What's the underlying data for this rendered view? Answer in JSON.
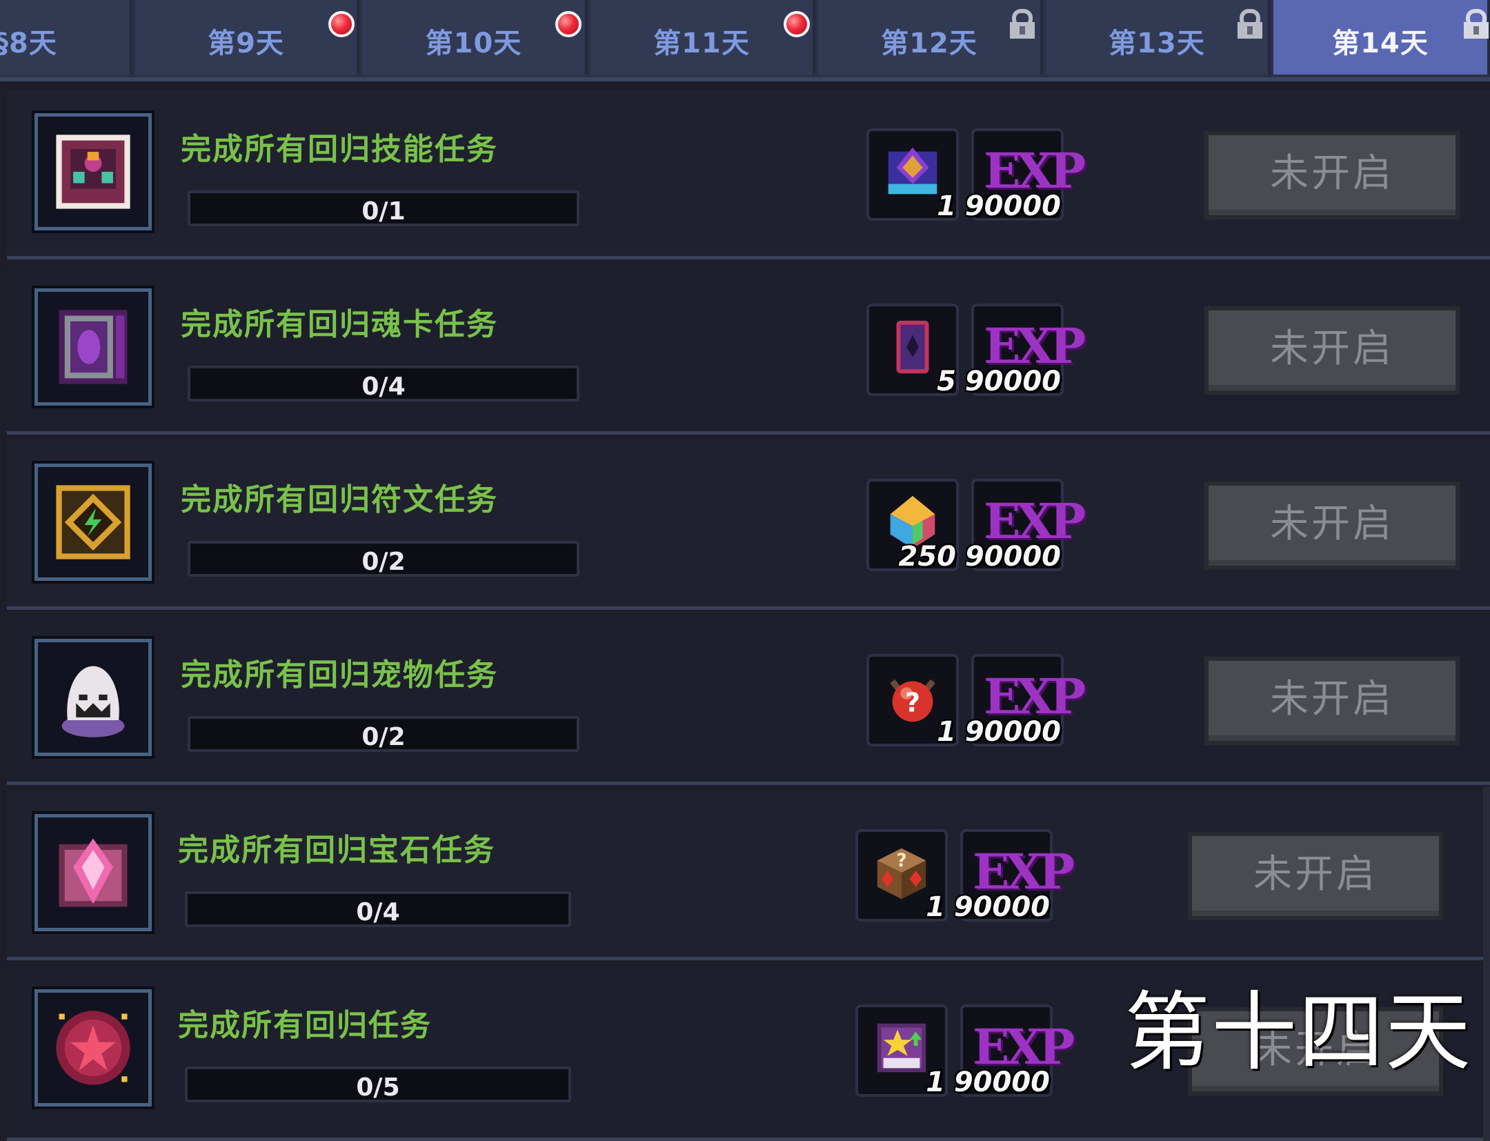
{
  "tabs": [
    {
      "label": "第8天",
      "visible_label": "§8天",
      "indicator": "none"
    },
    {
      "label": "第9天",
      "indicator": "red-dot"
    },
    {
      "label": "第10天",
      "indicator": "red-dot"
    },
    {
      "label": "第11天",
      "indicator": "red-dot"
    },
    {
      "label": "第12天",
      "indicator": "lock"
    },
    {
      "label": "第13天",
      "indicator": "lock"
    },
    {
      "label": "第14天",
      "indicator": "lock",
      "active": true
    }
  ],
  "tasks": [
    {
      "title": "完成所有回归技能任务",
      "progress": "0/1",
      "progress_fraction": 0,
      "icon": "skill-book-icon",
      "reward_item": {
        "icon": "skill-tome-icon",
        "count": "1"
      },
      "exp": {
        "label": "EXP",
        "amount": "90000"
      },
      "button": "未开启"
    },
    {
      "title": "完成所有回归魂卡任务",
      "progress": "0/4",
      "progress_fraction": 0,
      "icon": "soul-card-icon",
      "reward_item": {
        "icon": "card-pack-icon",
        "count": "5"
      },
      "exp": {
        "label": "EXP",
        "amount": "90000"
      },
      "button": "未开启"
    },
    {
      "title": "完成所有回归符文任务",
      "progress": "0/2",
      "progress_fraction": 0,
      "icon": "rune-icon",
      "reward_item": {
        "icon": "rune-crystal-icon",
        "count": "250"
      },
      "exp": {
        "label": "EXP",
        "amount": "90000"
      },
      "button": "未开启"
    },
    {
      "title": "完成所有回归宠物任务",
      "progress": "0/2",
      "progress_fraction": 0,
      "icon": "pet-egg-icon",
      "reward_item": {
        "icon": "mystery-egg-icon",
        "count": "1"
      },
      "exp": {
        "label": "EXP",
        "amount": "90000"
      },
      "button": "未开启"
    },
    {
      "title": "完成所有回归宝石任务",
      "progress": "0/4",
      "progress_fraction": 0,
      "icon": "gem-icon",
      "reward_item": {
        "icon": "mystery-chest-icon",
        "count": "1"
      },
      "exp": {
        "label": "EXP",
        "amount": "90000"
      },
      "button": "未开启"
    },
    {
      "title": "完成所有回归任务",
      "progress": "0/5",
      "progress_fraction": 0,
      "icon": "star-orb-icon",
      "reward_item": {
        "icon": "star-ticket-icon",
        "count": "1"
      },
      "exp": {
        "label": "EXP",
        "amount": "90000"
      },
      "button": "未开启"
    }
  ],
  "overlay_caption": "第十四天",
  "colors": {
    "title_green": "#79c24a",
    "tab_active": "#5a67b2",
    "button_disabled": "#4a4b51",
    "exp_purple": "#9d33c3"
  }
}
